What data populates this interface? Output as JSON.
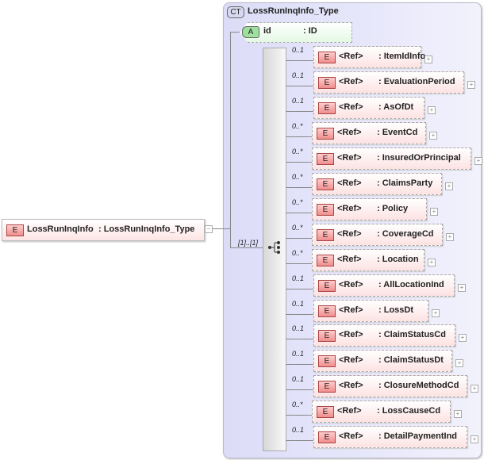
{
  "complex_type": {
    "badge": "CT",
    "name": "LossRunInqInfo_Type"
  },
  "attribute": {
    "badge": "A",
    "name": "id",
    "type": ": ID"
  },
  "root": {
    "badge": "E",
    "name": "LossRunInqInfo",
    "type": ": LossRunInqInfo_Type",
    "collapse": "−"
  },
  "sequence": {
    "cardinality": "[1]..[1]",
    "icon": "sequence-icon"
  },
  "items": [
    {
      "card": "0..1",
      "ref": "<Ref>",
      "name": ": ItemIdInfo"
    },
    {
      "card": "0..1",
      "ref": "<Ref>",
      "name": ": EvaluationPeriod"
    },
    {
      "card": "0..1",
      "ref": "<Ref>",
      "name": ": AsOfDt"
    },
    {
      "card": "0..*",
      "ref": "<Ref>",
      "name": ": EventCd"
    },
    {
      "card": "0..*",
      "ref": "<Ref>",
      "name": ": InsuredOrPrincipal"
    },
    {
      "card": "0..*",
      "ref": "<Ref>",
      "name": ": ClaimsParty"
    },
    {
      "card": "0..*",
      "ref": "<Ref>",
      "name": ": Policy"
    },
    {
      "card": "0..*",
      "ref": "<Ref>",
      "name": ": CoverageCd"
    },
    {
      "card": "0..*",
      "ref": "<Ref>",
      "name": ": Location"
    },
    {
      "card": "0..1",
      "ref": "<Ref>",
      "name": ": AllLocationInd"
    },
    {
      "card": "0..1",
      "ref": "<Ref>",
      "name": ": LossDt"
    },
    {
      "card": "0..1",
      "ref": "<Ref>",
      "name": ": ClaimStatusCd"
    },
    {
      "card": "0..1",
      "ref": "<Ref>",
      "name": ": ClaimStatusDt"
    },
    {
      "card": "0..1",
      "ref": "<Ref>",
      "name": ": ClosureMethodCd"
    },
    {
      "card": "0..*",
      "ref": "<Ref>",
      "name": ": LossCauseCd"
    },
    {
      "card": "0..1",
      "ref": "<Ref>",
      "name": ": DetailPaymentInd"
    }
  ],
  "badge_e": "E",
  "expand": "+"
}
